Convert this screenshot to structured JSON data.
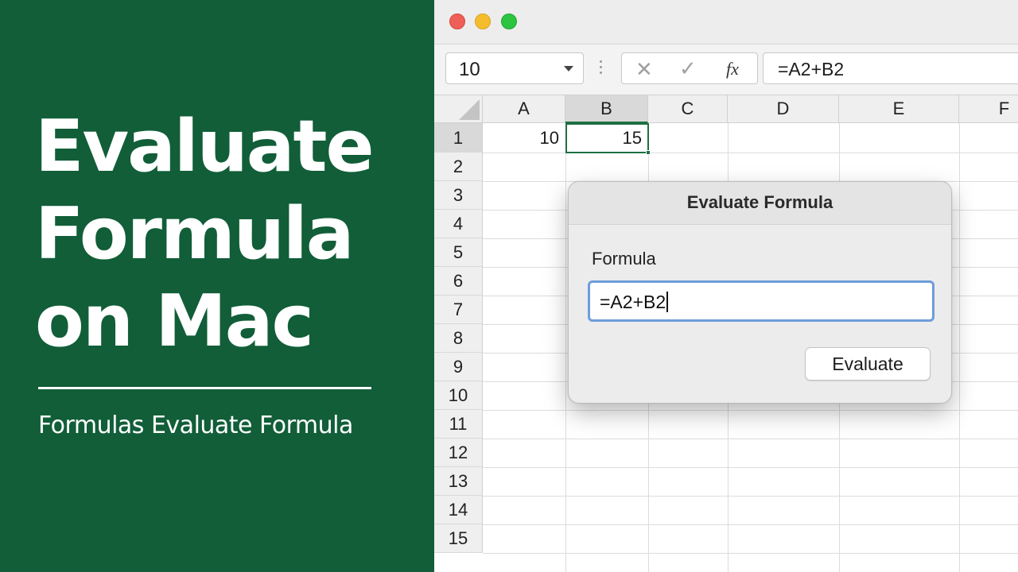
{
  "promo": {
    "title_lines": [
      "Evaluate",
      "Formula",
      "on Mac"
    ],
    "subtitle": "Formulas Evaluate Formula"
  },
  "window": {
    "traffic_lights": [
      "close",
      "minimize",
      "zoom"
    ]
  },
  "formula_bar": {
    "name_box_value": "10",
    "cancel_icon": "✕",
    "enter_icon": "✓",
    "fx_label": "fx",
    "formula_value": "=A2+B2"
  },
  "sheet": {
    "columns": [
      "A",
      "B",
      "C",
      "D",
      "E",
      "F"
    ],
    "selected_column": "B",
    "rows": [
      "1",
      "2",
      "3",
      "4",
      "5",
      "6",
      "7",
      "8",
      "9",
      "10",
      "11",
      "12",
      "13",
      "14",
      "15"
    ],
    "selected_row": "1",
    "cells": {
      "A1": "10",
      "B1": "15"
    }
  },
  "dialog": {
    "title": "Evaluate Formula",
    "field_label": "Formula",
    "field_value": "=A2+B2",
    "button_label": "Evaluate"
  },
  "colors": {
    "promo_green": "#115e38",
    "excel_green": "#1d6f42",
    "focus_blue": "#6e9ddb"
  }
}
